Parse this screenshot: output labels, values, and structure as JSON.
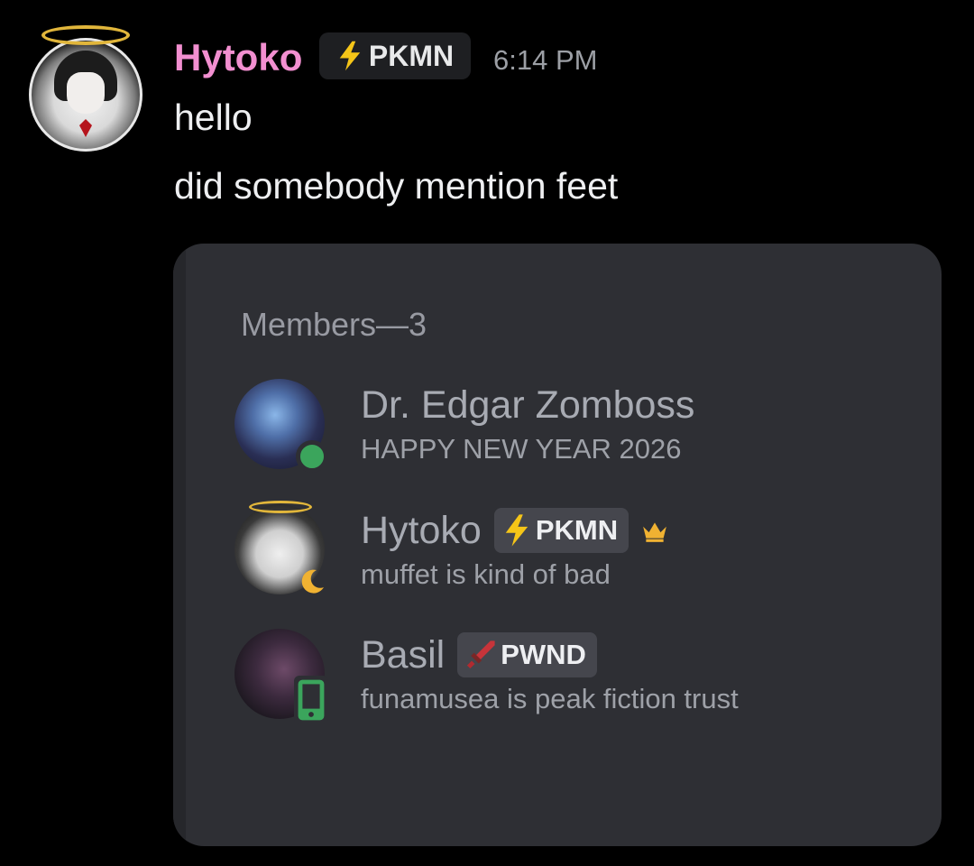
{
  "message": {
    "username": "Hytoko",
    "username_color": "#f28fd0",
    "tag": {
      "icon": "lightning-bolt-icon",
      "label": "PKMN"
    },
    "timestamp": "6:14 PM",
    "lines": [
      "hello",
      "did somebody mention feet"
    ]
  },
  "embed": {
    "members_header": "Members—3",
    "members": [
      {
        "name": "Dr. Edgar Zomboss",
        "status_text": "HAPPY NEW YEAR 2026",
        "presence": "online",
        "presence_icon": "online-dot-icon",
        "presence_color": "#3ba55c"
      },
      {
        "name": "Hytoko",
        "tag": {
          "icon": "lightning-bolt-icon",
          "label": "PKMN"
        },
        "owner_icon": "crown-icon",
        "status_text": "muffet is kind of bad",
        "presence": "idle",
        "presence_icon": "moon-icon",
        "presence_color": "#f0b232"
      },
      {
        "name": "Basil",
        "tag": {
          "icon": "sword-icon",
          "label": "PWND"
        },
        "status_text": "funamusea is peak fiction trust",
        "presence": "mobile-online",
        "presence_icon": "mobile-phone-icon",
        "presence_color": "#3ba55c"
      }
    ]
  },
  "colors": {
    "background": "#000000",
    "embed_bg": "#2e2f34",
    "text_primary": "#eeeff1",
    "text_muted": "#9c9fa5",
    "bolt": "#f5c518",
    "crown": "#f0b232"
  }
}
